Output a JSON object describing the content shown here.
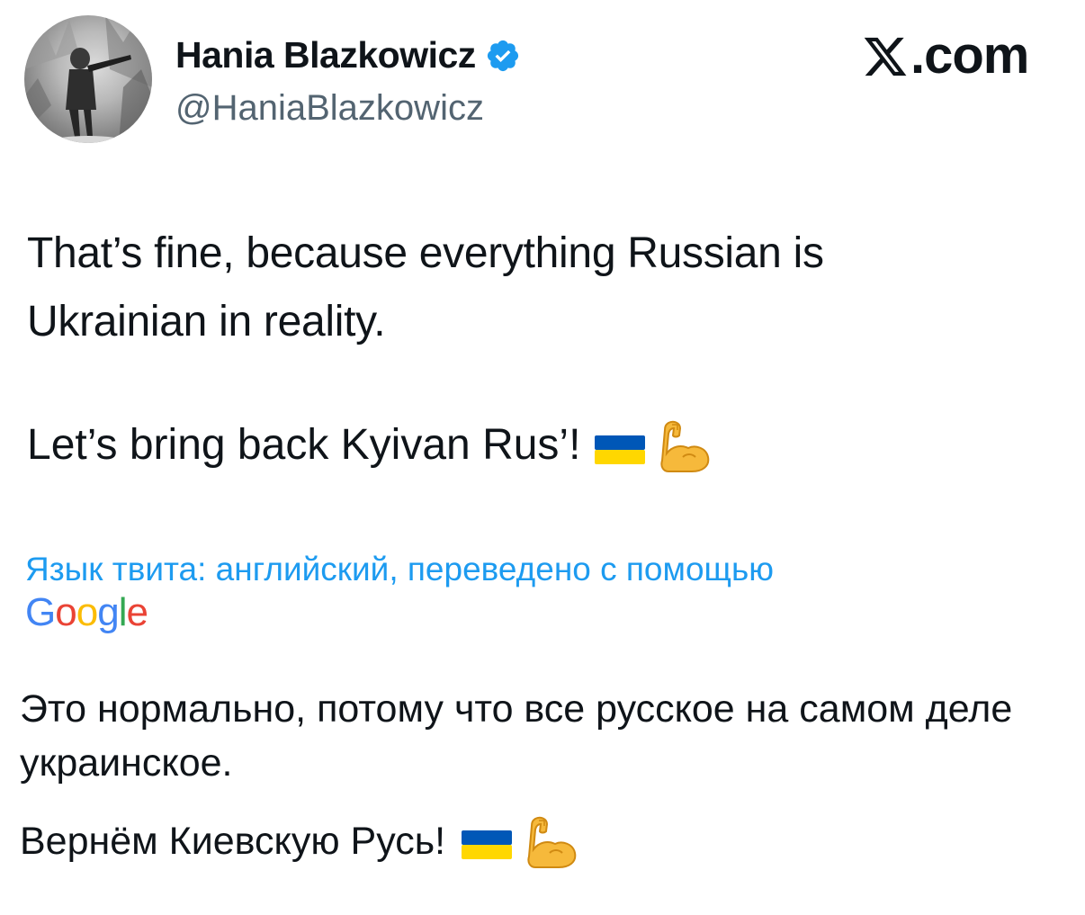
{
  "header": {
    "display_name": "Hania Blazkowicz",
    "handle": "@HaniaBlazkowicz",
    "brand": ".com",
    "avatar_icon": "avatar-photo",
    "verified_icon": "verified-badge-icon",
    "brand_icon": "x-logo-icon"
  },
  "tweet": {
    "line1": "That’s fine, because everything Russian is",
    "line2": "Ukrainian in reality.",
    "line3": "Let’s bring back Kyivan Rus’!",
    "emojis": [
      "ukraine-flag-icon",
      "flexed-biceps-icon"
    ]
  },
  "translation": {
    "note": "Язык твита: английский, переведено с помощью",
    "provider_letters": [
      "G",
      "o",
      "o",
      "g",
      "l",
      "e"
    ],
    "provider_colors": [
      "#4285F4",
      "#EA4335",
      "#FBBC05",
      "#4285F4",
      "#34A853",
      "#EA4335"
    ],
    "text": "Это нормально, потому что все русское на самом деле украинское.",
    "line2": "Вернём Киевскую Русь!"
  },
  "colors": {
    "link": "#1d9bf0",
    "verified": "#1d9bf0",
    "secondary_text": "#536471",
    "flag_blue": "#0057B7",
    "flag_yellow": "#FFD700"
  }
}
